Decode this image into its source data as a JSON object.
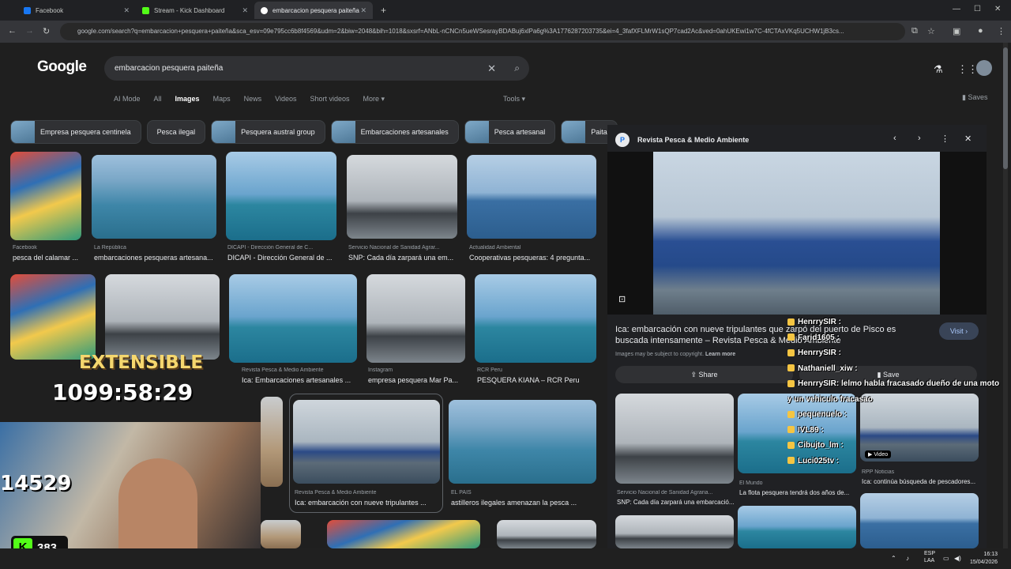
{
  "tabs": [
    {
      "label": "Facebook"
    },
    {
      "label": "Stream - Kick Dashboard"
    },
    {
      "label": "embarcacion pesquera paiteña"
    }
  ],
  "new_tab": "+",
  "window_controls": {
    "minimize": "—",
    "maximize": "☐",
    "close": "✕"
  },
  "url": "google.com/search?q=embarcacion+pesquera+paiteña&sca_esv=09e795cc6b8f4569&udm=2&biw=2048&bih=1018&sxsrf=ANbL-nCNCn5ueWSesrayBDABuj6xlPa6g%3A1776287203735&ei=4_3fafXFLMrW1sQP7cad2Ac&ved=0ahUKEwi1w7C-4fCTAxVKq5UCHW1jB3cs...",
  "google": {
    "logo": "Google",
    "query": "embarcacion pesquera paiteña",
    "filters": [
      "AI Mode",
      "All",
      "Images",
      "Maps",
      "News",
      "Videos",
      "Short videos",
      "More ▾"
    ],
    "active_filter": "Images",
    "tools": "Tools ▾",
    "saves": "Saves"
  },
  "chips": [
    {
      "label": "Empresa pesquera centinela",
      "thumb": true
    },
    {
      "label": "Pesca ilegal",
      "thumb": false
    },
    {
      "label": "Pesquera austral group",
      "thumb": true
    },
    {
      "label": "Embarcaciones artesanales",
      "thumb": true
    },
    {
      "label": "Pesca artesanal",
      "thumb": true
    },
    {
      "label": "Paita",
      "thumb": true
    }
  ],
  "results": [
    {
      "source": "Facebook",
      "title": "pesca del calamar ..."
    },
    {
      "source": "La República",
      "title": "embarcaciones pesqueras artesana..."
    },
    {
      "source": "DICAPI - Dirección General de C...",
      "title": "DICAPI - Dirección General de ..."
    },
    {
      "source": "Servicio Nacional de Sanidad Agrar...",
      "title": "SNP: Cada día zarpará una em..."
    },
    {
      "source": "Actualidad Ambiental",
      "title": "Cooperativas pesqueras: 4 pregunta..."
    },
    {
      "source": "Revista Pesca & Medio Ambiente",
      "title": "Ica: Embarcaciones artesanales ..."
    },
    {
      "source": "Instagram",
      "title": "empresa pesquera Mar Pa..."
    },
    {
      "source": "RCR Peru",
      "title": "PESQUERA KIANA – RCR Peru"
    },
    {
      "source": "Revista Pesca & Medio Ambiente",
      "title": "Ica: embarcación con nueve tripulantes ..."
    },
    {
      "source": "EL PAÍS",
      "title": "astilleros ilegales amenazan la pesca ..."
    }
  ],
  "panel": {
    "site": "Revista Pesca & Medio Ambiente",
    "site_initial": "P",
    "title": "Ica: embarcación con nueve tripulantes que zarpó del puerto de Pisco es buscada intensamente – Revista Pesca & Medio Ambiente",
    "copyright": "Images may be subject to copyright.",
    "learn_more": "Learn more",
    "visit": "Visit ›",
    "share": "Share",
    "save": "Save",
    "related": [
      {
        "source": "Servicio Nacional de Sanidad Agraria...",
        "title": "SNP: Cada día zarpará una embarcació..."
      },
      {
        "source": "El Mundo",
        "title": "La flota pesquera tendrá dos años de..."
      },
      {
        "source": "RPP Noticias",
        "title": "Ica: continúa búsqueda de pescadores..."
      }
    ],
    "video_badge": "▶ Video"
  },
  "stream": {
    "extensible_label": "EXTENSIBLE",
    "timer": "1099:58:29",
    "number": "14529",
    "kick_count": "383"
  },
  "chat": [
    {
      "user": "HenrrySIR",
      "msg": ""
    },
    {
      "user": "Farid1605",
      "msg": ""
    },
    {
      "user": "HenrrySIR",
      "msg": ""
    },
    {
      "user": "Nathaniell_xiw",
      "msg": ""
    },
    {
      "user": "HenrrySIR",
      "msg": ": lelmo habla fracasado dueño de una moto"
    },
    {
      "user": "",
      "msg": "y un vehiculo  fracasao"
    },
    {
      "user": "pequenuelo",
      "msg": ""
    },
    {
      "user": "IVL89",
      "msg": ""
    },
    {
      "user": "Cibujto_lm",
      "msg": ""
    },
    {
      "user": "Luci025tv",
      "msg": ""
    }
  ],
  "taskbar": {
    "lang": "ESP",
    "lang2": "LAA",
    "time": "16:13",
    "date": "15/04/2026"
  }
}
